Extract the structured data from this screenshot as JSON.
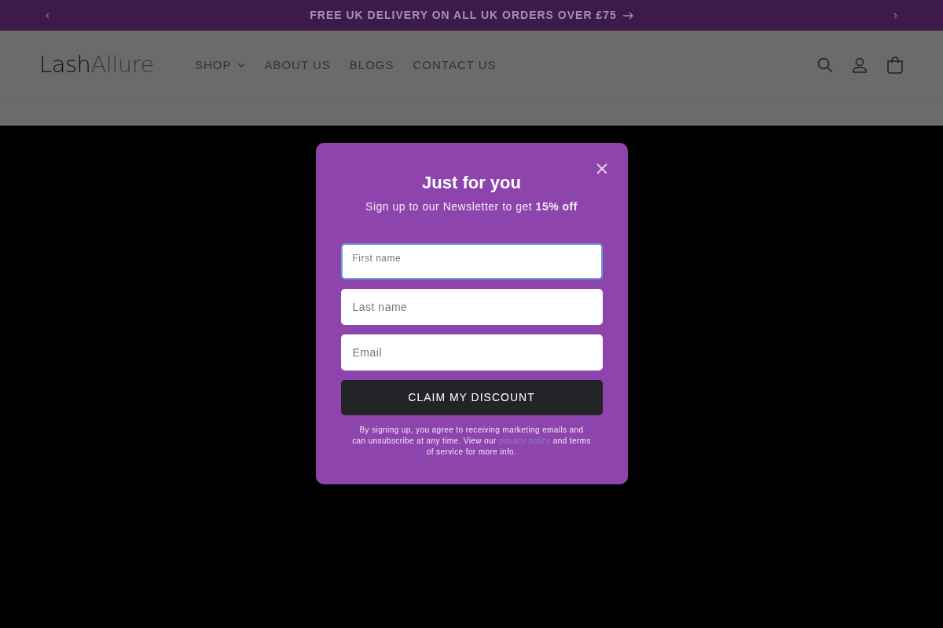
{
  "announcement": {
    "text": "FREE UK DELIVERY ON ALL UK ORDERS OVER £75"
  },
  "header": {
    "logo": {
      "dark": "Lash",
      "light": "Allure"
    },
    "nav": [
      {
        "label": "SHOP",
        "dropdown": true
      },
      {
        "label": "ABOUT US",
        "dropdown": false
      },
      {
        "label": "BLOGS",
        "dropdown": false
      },
      {
        "label": "CONTACT US",
        "dropdown": false
      }
    ]
  },
  "popup": {
    "title": "Just for you",
    "subtitle": "Sign up to our Newsletter to get **15% off**",
    "fields": [
      {
        "kind": "floating",
        "label": "First name",
        "focused": true
      },
      {
        "kind": "plain",
        "placeholder": "Last name",
        "focused": false
      },
      {
        "kind": "plain",
        "placeholder": "Email",
        "focused": false
      }
    ],
    "button": "CLAIM MY DISCOUNT",
    "disclaimer": {
      "before": "By signing up, you agree to receiving marketing emails and can unsubscribe at any time. View our",
      "link": "privacy policy",
      "after": "and terms of service for more info."
    }
  }
}
